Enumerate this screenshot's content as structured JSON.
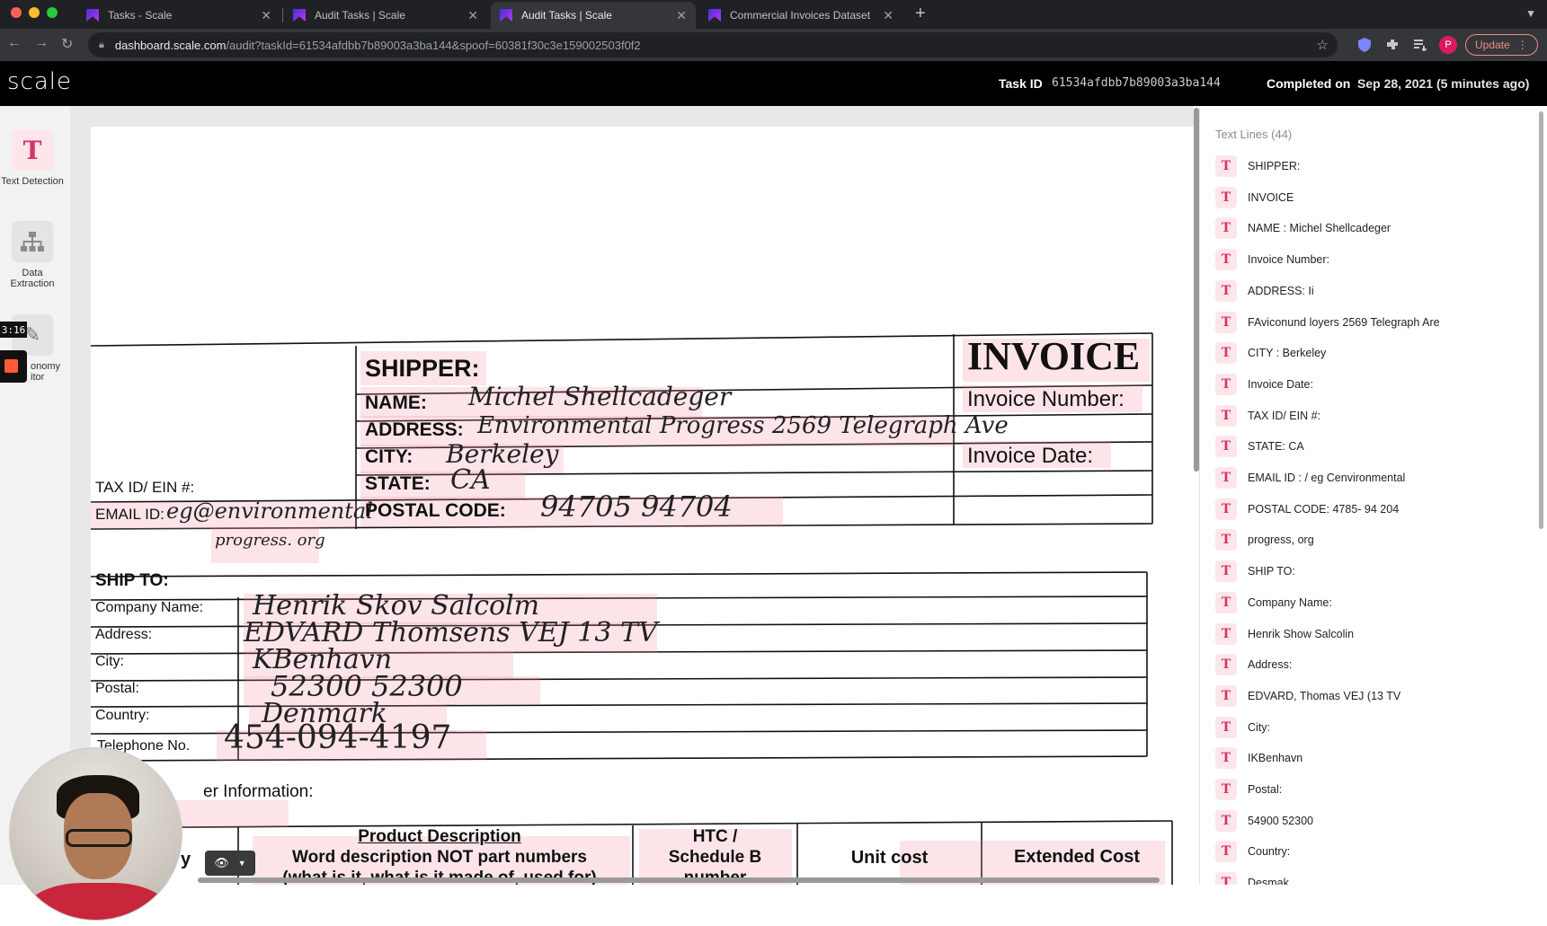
{
  "browser": {
    "tabs": [
      {
        "title": "Tasks - Scale",
        "active": false
      },
      {
        "title": "Audit Tasks | Scale",
        "active": false
      },
      {
        "title": "Audit Tasks | Scale",
        "active": true
      },
      {
        "title": "Commercial Invoices Dataset",
        "active": false
      }
    ],
    "url_host": "dashboard.scale.com",
    "url_path": "/audit?taskId=61534afdbb7b89003a3ba144&spoof=60381f30c3e159002503f0f2",
    "profile_initial": "P",
    "update_label": "Update"
  },
  "header": {
    "logo": "scale",
    "task_id_label": "Task ID",
    "task_id": "61534afdbb7b89003a3ba144",
    "completed_label": "Completed on",
    "completed_value": "Sep 28, 2021 (5 minutes ago)"
  },
  "tools": [
    {
      "label": "Text Detection",
      "icon": "text-t-icon"
    },
    {
      "label": "Data Extraction",
      "icon": "hierarchy-icon"
    },
    {
      "label": "onomy itor",
      "icon": "pencil-edit-icon"
    }
  ],
  "recording": {
    "timer": "3:16"
  },
  "document": {
    "shipper_heading": "SHIPPER:",
    "invoice_heading": "INVOICE",
    "name_label": "NAME:",
    "name_value": "Michel Shellcadeger",
    "address_label": "ADDRESS:",
    "address_value": "Environmental Progress  2569 Telegraph Ave",
    "city_label": "CITY:",
    "city_value": "Berkeley",
    "state_label": "STATE:",
    "state_value": "CA",
    "postal_label": "POSTAL CODE:",
    "postal_value": "94705 94704",
    "taxid_label": "TAX ID/ EIN #:",
    "email_label": "EMAIL ID:",
    "email_value": "eg@environmental",
    "email_value2": "progress. org",
    "invoice_number_label": "Invoice Number:",
    "invoice_date_label": "Invoice Date:",
    "shipto_heading": "SHIP TO:",
    "company_label": "Company Name:",
    "company_value": "Henrik Skov Salcolm",
    "st_address_label": "Address:",
    "st_address_value": "EDVARD Thomsens VEJ 13 TV",
    "st_city_label": "City:",
    "st_city_value": "KBenhavn",
    "st_postal_label": "Postal:",
    "st_postal_value": "52300  52300",
    "st_country_label": "Country:",
    "st_country_value": "Denmark",
    "phone_label": "Telephone No.",
    "phone_value": "454-094-4197",
    "other_info": "er Information:",
    "col_qty": "y",
    "col_product_1": "Product Description",
    "col_product_2": "Word description NOT part numbers",
    "col_product_3": "(what is it, what is it made of, used for)",
    "col_htc_1": "HTC /",
    "col_htc_2": "Schedule B",
    "col_htc_3": "number",
    "col_unit": "Unit cost",
    "col_extended": "Extended Cost"
  },
  "panel": {
    "title": "Text Lines (44)",
    "lines": [
      "SHIPPER:",
      "INVOICE",
      "NAME : Michel Shellcadeger",
      "Invoice Number:",
      "ADDRESS: Ii",
      "FAviconund loyers 2569 Telegraph Are",
      "CITY : Berkeley",
      "Invoice Date:",
      "TAX ID/ EIN #:",
      "STATE: CA",
      "EMAIL ID : / eg Cenvironmental",
      "POSTAL CODE: 4785- 94 204",
      "progress, org",
      "SHIP TO:",
      "Company Name:",
      "Henrik Show Salcolin",
      "Address:",
      "EDVARD, Thomas VEJ (13 TV",
      "City:",
      "IKBenhavn",
      "Postal:",
      "54900 52300",
      "Country:",
      "Desmak"
    ]
  },
  "colors": {
    "accent": "#d6336c",
    "highlight": "#f5c6cf",
    "header_bg": "#000000"
  }
}
